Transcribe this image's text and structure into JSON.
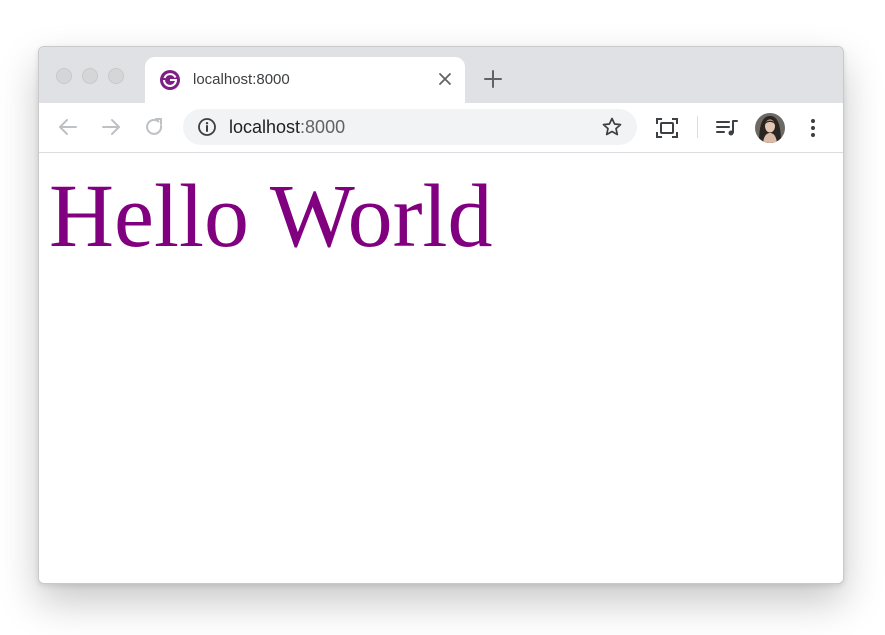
{
  "browser": {
    "tab": {
      "title": "localhost:8000",
      "favicon": "gatsby-logo-icon",
      "favicon_color": "#7e1f86"
    },
    "toolbar": {
      "back_icon": "arrow-left-icon",
      "forward_icon": "arrow-right-icon",
      "reload_icon": "reload-icon",
      "cast_icon": "screen-capture-icon",
      "media_icon": "media-playlist-icon",
      "menu_icon": "vertical-dots-icon"
    },
    "omnibox": {
      "info_icon": "info-icon",
      "host": "localhost",
      "port": ":8000",
      "bookmark_icon": "star-icon"
    }
  },
  "page": {
    "heading": "Hello World",
    "heading_color": "#800080"
  }
}
